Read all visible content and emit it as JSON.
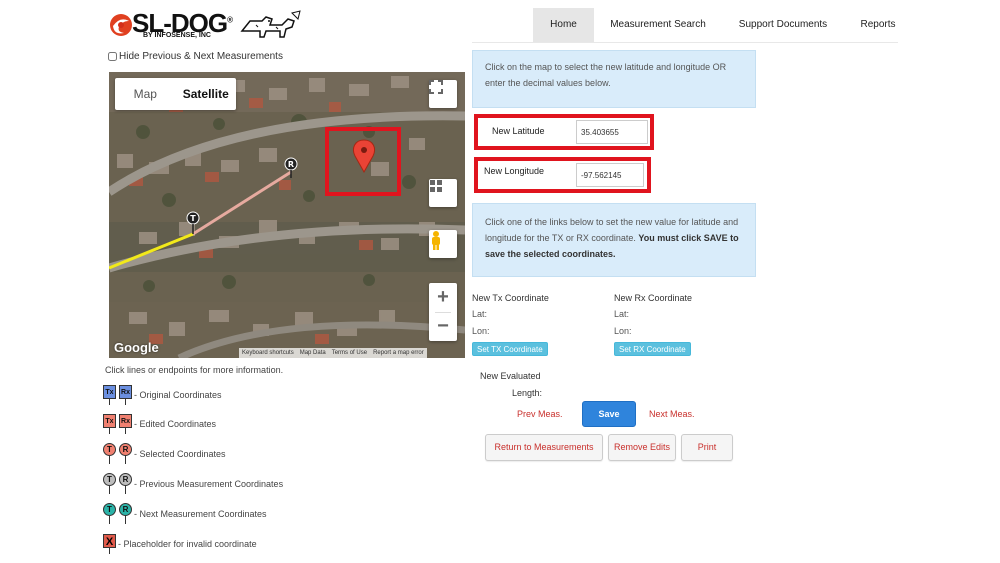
{
  "brand": {
    "name": "SL-DOG",
    "registered": "®",
    "sub": "BY INFOSENSE, INC"
  },
  "nav": {
    "items": [
      "Home",
      "Measurement Search",
      "Support Documents",
      "Reports"
    ],
    "active": "Home"
  },
  "options": {
    "hide_prev_next_label": "Hide Previous & Next Measurements",
    "hide_prev_next_checked": false
  },
  "map": {
    "type_map": "Map",
    "type_satellite": "Satellite",
    "selected_type": "Satellite",
    "google_label": "Google",
    "attribution": [
      "Keyboard shortcuts",
      "Map Data",
      "Terms of Use",
      "Report a map error"
    ],
    "pins": [
      {
        "label": "R"
      },
      {
        "label": "T"
      }
    ]
  },
  "legend": {
    "header": "Click lines or endpoints for more information.",
    "items": [
      {
        "pin_a": "Tx",
        "pin_b": "Rx",
        "style": "square",
        "color": "#6b8fe0",
        "text": "- Original Coordinates"
      },
      {
        "pin_a": "Tx",
        "pin_b": "Rx",
        "style": "square",
        "color": "#f08070",
        "text": "- Edited Coordinates"
      },
      {
        "pin_a": "T",
        "pin_b": "R",
        "style": "round",
        "color": "#f08070",
        "text": "- Selected Coordinates"
      },
      {
        "pin_a": "T",
        "pin_b": "R",
        "style": "round",
        "color": "#bdbdbd",
        "text": "- Previous Measurement Coordinates"
      },
      {
        "pin_a": "T",
        "pin_b": "R",
        "style": "round",
        "color": "#2bb3a8",
        "text": "- Next Measurement Coordinates"
      },
      {
        "pin_a": "X",
        "pin_b": "",
        "style": "placeholder",
        "color": "#e05a4a",
        "text": "- Placeholder for invalid coordinate"
      }
    ]
  },
  "panel": {
    "info1": "Click on the map to select the new latitude and longitude OR enter the decimal values below.",
    "new_latitude_label": "New Latitude",
    "new_latitude_value": "35.403655",
    "new_longitude_label": "New Longitude",
    "new_longitude_value": "-97.562145",
    "info2_text": "Click one of the links below to set the new value for latitude and longitude for the TX or RX coordinate. ",
    "info2_bold": "You must click SAVE to save the selected coordinates.",
    "tx": {
      "heading": "New Tx Coordinate",
      "lat_label": "Lat:",
      "lon_label": "Lon:",
      "button": "Set TX Coordinate"
    },
    "rx": {
      "heading": "New Rx Coordinate",
      "lat_label": "Lat:",
      "lon_label": "Lon:",
      "button": "Set RX Coordinate"
    },
    "new_evaluated_line1": "New Evaluated",
    "new_evaluated_line2": "Length:",
    "prev_meas": "Prev Meas.",
    "save": "Save",
    "next_meas": "Next Meas.",
    "return": "Return to Measurements",
    "remove_edits": "Remove Edits",
    "print": "Print"
  },
  "colors": {
    "highlight_red": "#e0141e",
    "info_bg": "#d9ecfa",
    "save_blue": "#2f84dc",
    "set_btn": "#5bc0de",
    "link_red": "#c9302c"
  }
}
